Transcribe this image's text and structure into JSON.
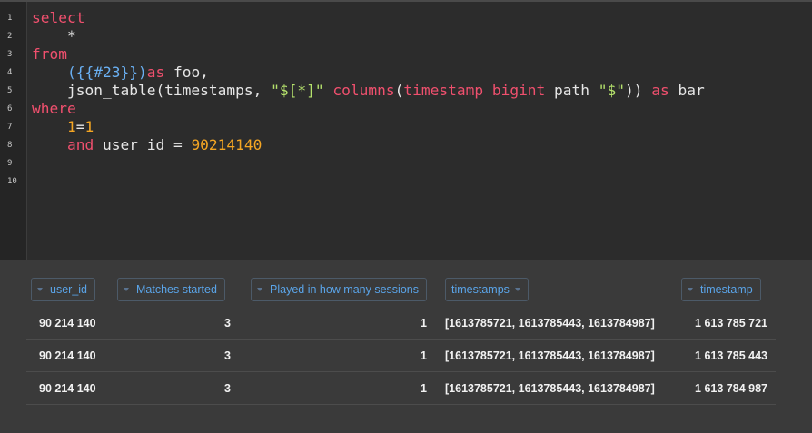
{
  "editor": {
    "line_numbers": [
      "1",
      "2",
      "3",
      "4",
      "5",
      "6",
      "7",
      "8",
      "9",
      "10"
    ],
    "lines": [
      [
        {
          "t": "select",
          "c": "kw"
        }
      ],
      [
        {
          "t": "    *",
          "c": ""
        }
      ],
      [
        {
          "t": "from",
          "c": "kw"
        }
      ],
      [
        {
          "t": "    ",
          "c": ""
        },
        {
          "t": "({{#23}})",
          "c": "br"
        },
        {
          "t": "as",
          "c": "kw"
        },
        {
          "t": " foo,",
          "c": ""
        }
      ],
      [
        {
          "t": "    json_table(timestamps, ",
          "c": ""
        },
        {
          "t": "\"$[*]\"",
          "c": "str"
        },
        {
          "t": " ",
          "c": ""
        },
        {
          "t": "columns",
          "c": "kw"
        },
        {
          "t": "(",
          "c": ""
        },
        {
          "t": "timestamp",
          "c": "kw"
        },
        {
          "t": " ",
          "c": ""
        },
        {
          "t": "bigint",
          "c": "kw"
        },
        {
          "t": " path ",
          "c": ""
        },
        {
          "t": "\"$\"",
          "c": "str"
        },
        {
          "t": "))",
          "c": ""
        },
        {
          "t": " as",
          "c": "kw"
        },
        {
          "t": " bar",
          "c": ""
        }
      ],
      [
        {
          "t": "where",
          "c": "kw"
        }
      ],
      [
        {
          "t": "    ",
          "c": ""
        },
        {
          "t": "1",
          "c": "num"
        },
        {
          "t": "=",
          "c": ""
        },
        {
          "t": "1",
          "c": "num"
        }
      ],
      [
        {
          "t": "    ",
          "c": ""
        },
        {
          "t": "and",
          "c": "kw"
        },
        {
          "t": " user_id = ",
          "c": ""
        },
        {
          "t": "90214140",
          "c": "num"
        }
      ],
      [],
      []
    ]
  },
  "results": {
    "columns": [
      {
        "label": "user_id"
      },
      {
        "label": "Matches started"
      },
      {
        "label": "Played in how many sessions"
      },
      {
        "label": "timestamps"
      },
      {
        "label": "timestamp"
      }
    ],
    "rows": [
      [
        "90 214 140",
        "3",
        "1",
        "[1613785721, 1613785443, 1613784987]",
        "1 613 785 721"
      ],
      [
        "90 214 140",
        "3",
        "1",
        "[1613785721, 1613785443, 1613784987]",
        "1 613 785 443"
      ],
      [
        "90 214 140",
        "3",
        "1",
        "[1613785721, 1613785443, 1613784987]",
        "1 613 784 987"
      ]
    ]
  },
  "colors": {
    "keyword": "#f0506e",
    "bracket": "#6ab0f3",
    "string": "#b5e26c",
    "number": "#f5a623",
    "header_text": "#5aa4e8"
  }
}
